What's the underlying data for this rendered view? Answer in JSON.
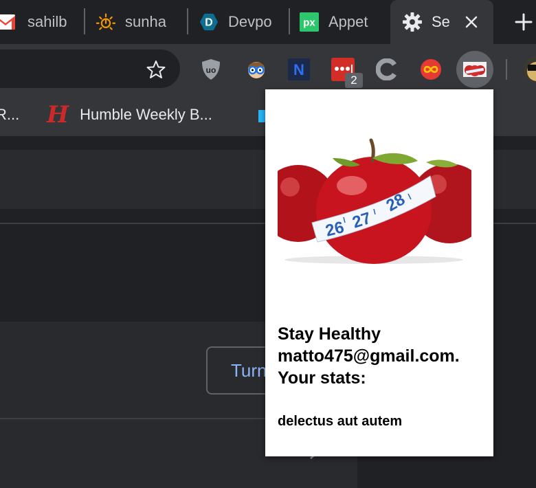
{
  "tabs": [
    {
      "title": "sahilb",
      "icon": "gmail-icon"
    },
    {
      "title": "sunha",
      "icon": "sun-icon"
    },
    {
      "title": "Devpo",
      "icon": "devpost-icon"
    },
    {
      "title": "Appet",
      "icon": "pixabay-icon"
    },
    {
      "title": "Se",
      "icon": "gear-icon",
      "active": true
    }
  ],
  "tab_icons": {
    "gmail": "M",
    "devpost": "D",
    "pixabay": "px"
  },
  "toolbar": {
    "badge_count": "2",
    "ublock_label": "uo",
    "n_label": "N"
  },
  "bookmarks": [
    {
      "label": "R..."
    },
    {
      "label": "Humble Weekly B...",
      "icon_glyph": "H"
    }
  ],
  "page": {
    "button_label": "Turn"
  },
  "popup": {
    "line1": "Stay Healthy",
    "line2": "matto475@gmail.com.",
    "line3": "Your stats:",
    "stat": "delectus aut autem",
    "measure_digits": [
      "26",
      "27",
      "28"
    ]
  },
  "colors": {
    "tabbar_bg": "#202124",
    "toolbar_bg": "#35363a",
    "accent_blue": "#8ab4f8",
    "popup_bg": "#ffffff",
    "gmail_red": "#ea4335",
    "sun_orange": "#f29900",
    "devpost_teal": "#003e54",
    "pixabay_green": "#2ec66d"
  }
}
